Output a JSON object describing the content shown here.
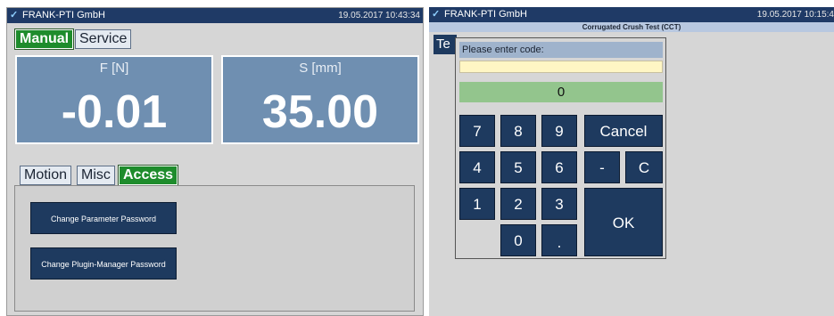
{
  "left_screen": {
    "title": "FRANK-PTI GmbH",
    "datetime": "19.05.2017 10:43:34",
    "mode_tabs": [
      {
        "label": "Manual",
        "active": true
      },
      {
        "label": "Service",
        "active": false
      }
    ],
    "force": {
      "label": "F [N]",
      "value": "-0.01"
    },
    "stroke": {
      "label": "S [mm]",
      "value": "35.00"
    },
    "section_tabs": [
      {
        "label": "Motion",
        "active": false
      },
      {
        "label": "Misc",
        "active": false
      },
      {
        "label": "Access",
        "active": true
      }
    ],
    "buttons": {
      "change_parameter_password": "Change Parameter Password",
      "change_plugin_manager_password": "Change Plugin-Manager Password"
    }
  },
  "right_screen": {
    "title": "FRANK-PTI GmbH",
    "datetime": "19.05.2017 10:15:4",
    "subtitle": "Corrugated Crush Test (CCT)",
    "tab_fragment": "Te",
    "keypad_dialog": {
      "prompt": "Please enter code:",
      "input_value": "",
      "display_value": "0",
      "keys": {
        "k7": "7",
        "k8": "8",
        "k9": "9",
        "cancel": "Cancel",
        "k4": "4",
        "k5": "5",
        "k6": "6",
        "minus": "-",
        "clear": "C",
        "k1": "1",
        "k2": "2",
        "k3": "3",
        "ok": "OK",
        "k0": "0",
        "dot": "."
      }
    }
  },
  "colors": {
    "titlebar": "#1f3a66",
    "active_tab": "#1e8c2c",
    "measure_panel": "#6f8fb1",
    "button": "#1e3a5f",
    "display_green": "#93c58d",
    "input_yellow": "#fff6c4"
  },
  "icons": {
    "title_logo": "check-icon"
  }
}
